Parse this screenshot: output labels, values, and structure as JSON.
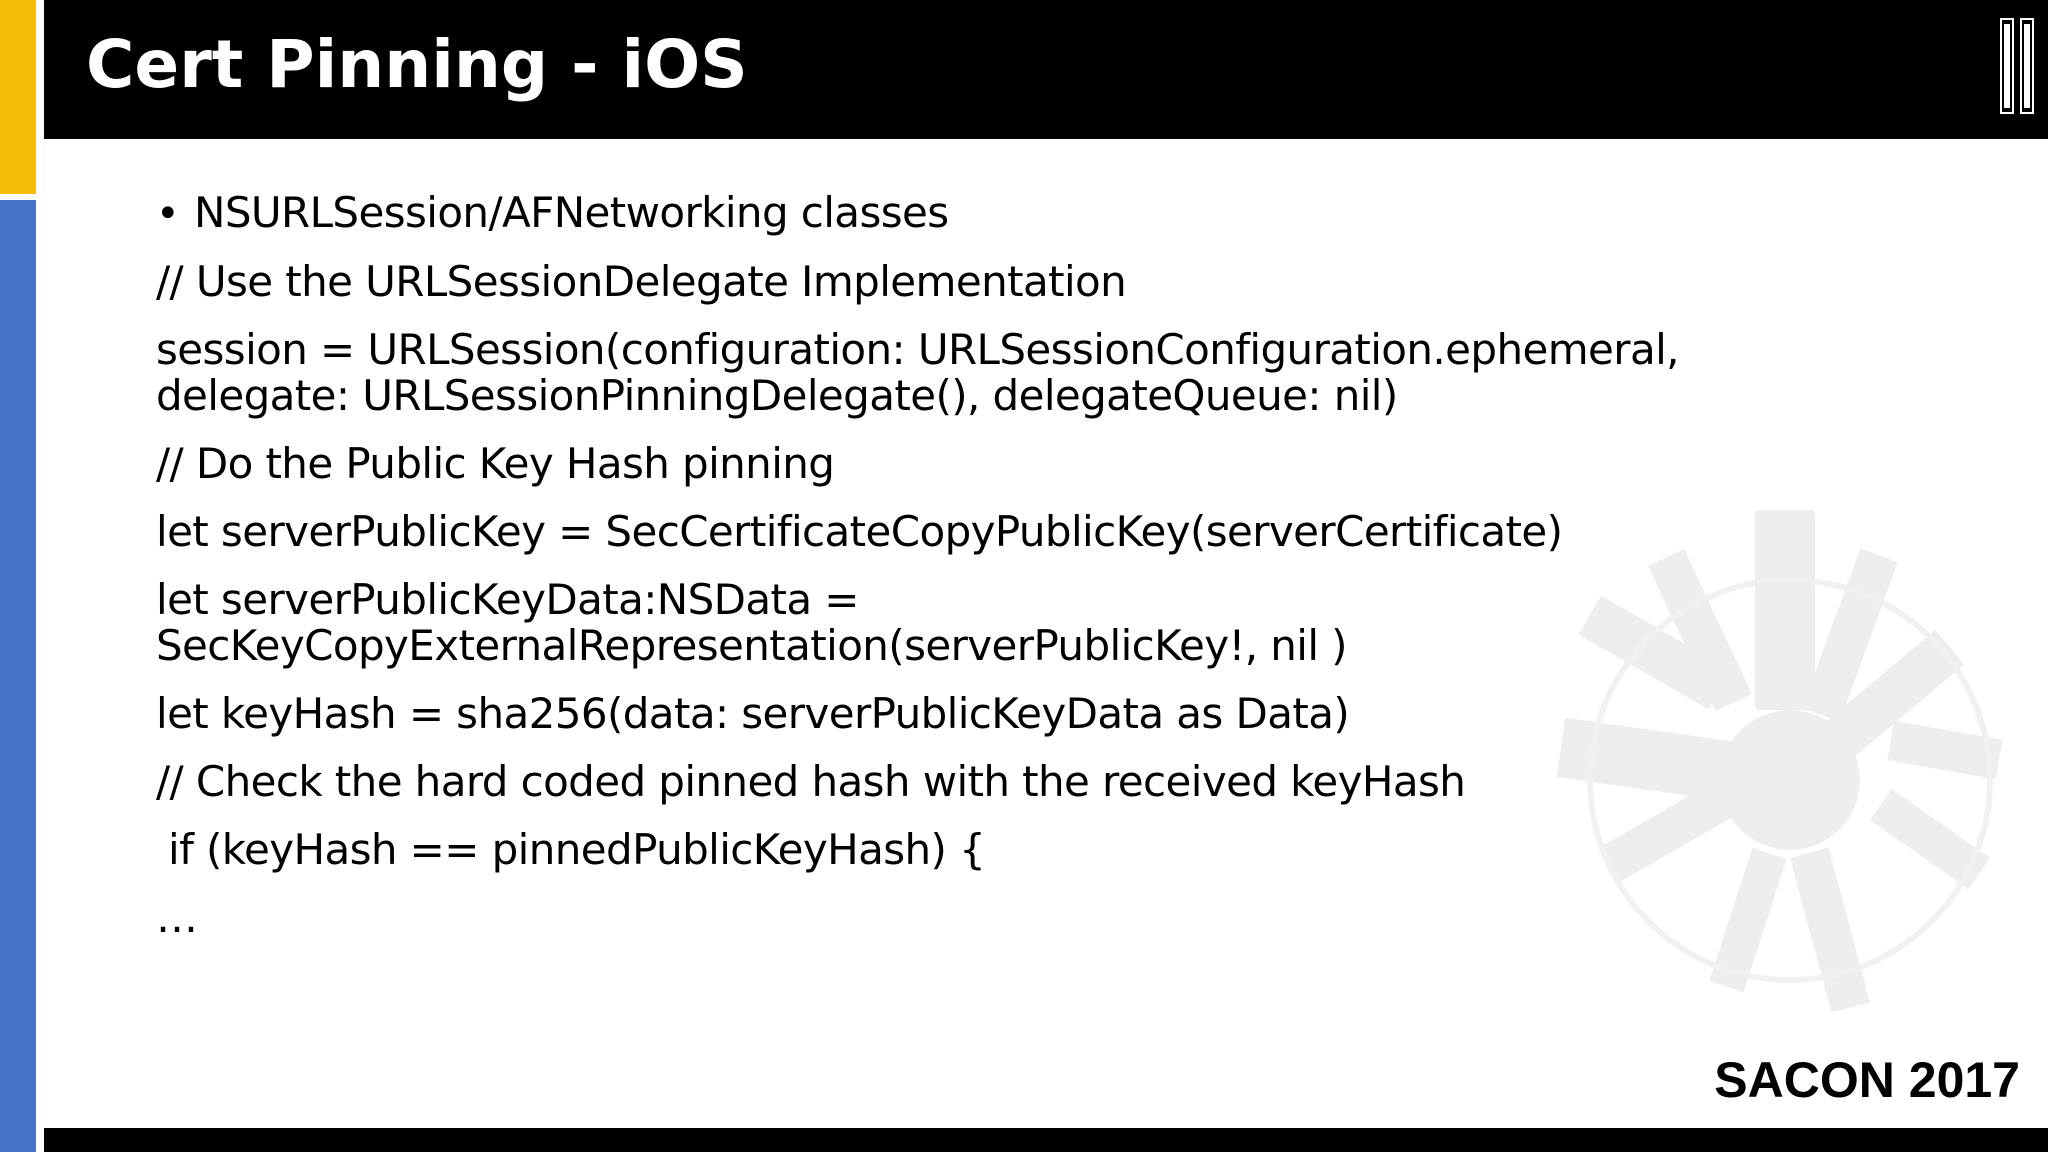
{
  "slide": {
    "title": "Cert Pinning - iOS",
    "bullet": "NSURLSession/AFNetworking classes",
    "bullet_glyph": "•",
    "lines": [
      "// Use the URLSessionDelegate Implementation",
      "session = URLSession(configuration: URLSessionConfiguration.ephemeral,",
      "delegate: URLSessionPinningDelegate(), delegateQueue: nil)",
      "// Do the Public Key Hash pinning",
      "let serverPublicKey = SecCertificateCopyPublicKey(serverCertificate)",
      "let serverPublicKeyData:NSData =",
      "SecKeyCopyExternalRepresentation(serverPublicKey!, nil )",
      "let keyHash = sha256(data: serverPublicKeyData as Data)",
      "// Check the hard coded pinned hash with the received keyHash",
      "if (keyHash == pinnedPublicKeyHash) {",
      "…"
    ],
    "footer_brand": "SACON 2017"
  },
  "colors": {
    "accent_yellow": "#f5bd0a",
    "accent_blue": "#4472c4",
    "header_bg": "#000000",
    "title_text": "#ffffff"
  },
  "icons": {
    "top_right": "pause-icon",
    "watermark": "city-skyline-watermark"
  }
}
